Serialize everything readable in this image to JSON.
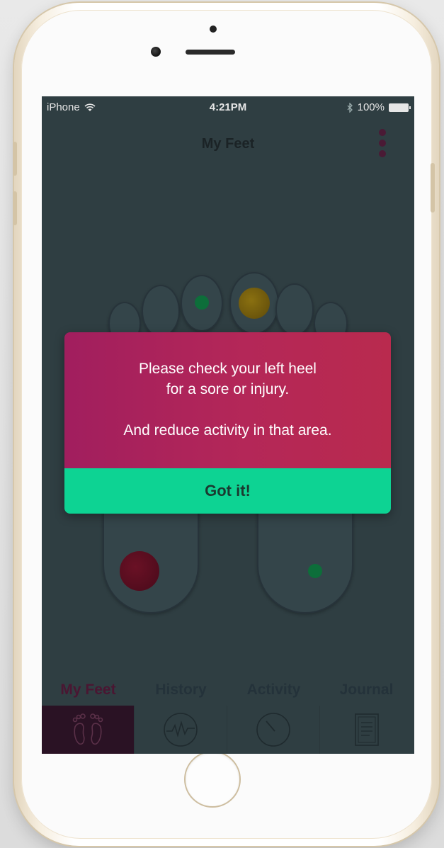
{
  "status_bar": {
    "carrier": "iPhone",
    "time": "4:21PM",
    "battery": "100%"
  },
  "header": {
    "title": "My Feet"
  },
  "alert": {
    "line1": "Please check your left heel",
    "line2": "for a sore or injury.",
    "line3": "And reduce activity in that area.",
    "button_label": "Got it!"
  },
  "tabs": [
    {
      "label": "My Feet",
      "icon": "feet-icon",
      "active": true
    },
    {
      "label": "History",
      "icon": "history-wave-icon",
      "active": false
    },
    {
      "label": "Activity",
      "icon": "activity-gauge-icon",
      "active": false
    },
    {
      "label": "Journal",
      "icon": "journal-notebook-icon",
      "active": false
    }
  ],
  "colors": {
    "alert_gradient_start": "#a11e5e",
    "alert_gradient_end": "#b92a4e",
    "button_green": "#0dd393",
    "screen_overlay": "#2f3e42",
    "active_tab": "#4a1632"
  }
}
